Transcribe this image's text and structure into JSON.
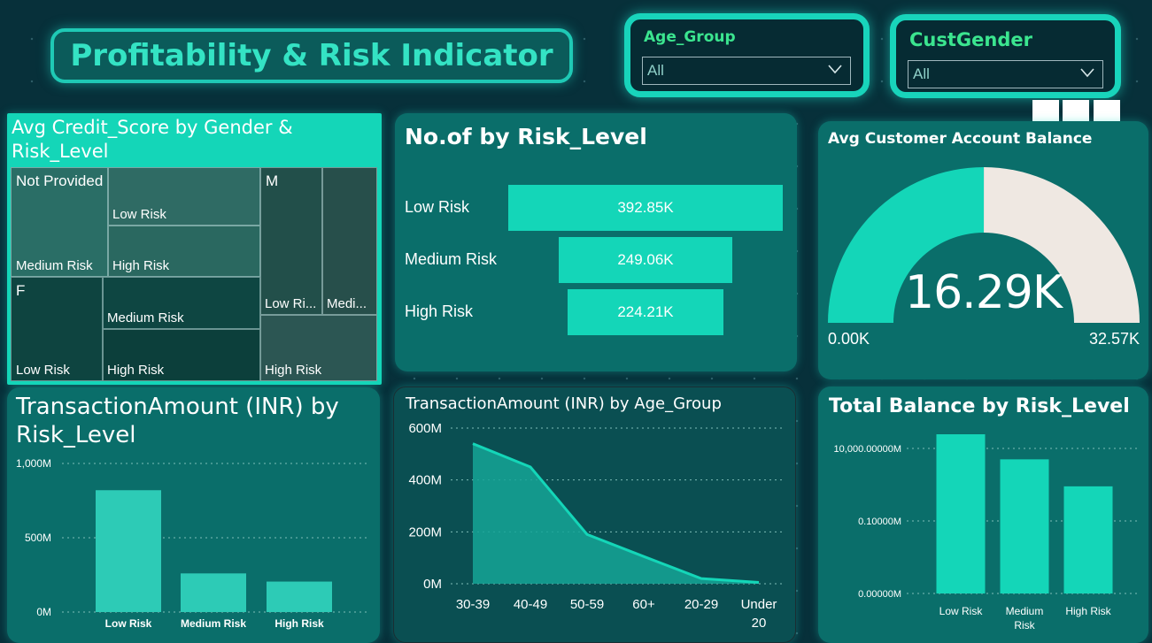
{
  "page_title": "Profitability & Risk Indicator",
  "slicers": {
    "age_group": {
      "label": "Age_Group",
      "value": "All"
    },
    "cust_gender": {
      "label": "CustGender",
      "value": "All"
    }
  },
  "colors": {
    "accent": "#14d6b8",
    "panel": "#0a6e6a",
    "background": "#07303a"
  },
  "treemap": {
    "title": "Avg Credit_Score by Gender & Risk_Level",
    "groups": [
      {
        "name": "Not Provided",
        "cells": [
          "Low Risk",
          "Medium Risk",
          "High Risk"
        ]
      },
      {
        "name": "F",
        "cells": [
          "Medium Risk",
          "Low Risk",
          "High Risk"
        ]
      },
      {
        "name": "M",
        "cells": [
          "Low Ri...",
          "Medi...",
          "High Risk"
        ]
      }
    ]
  },
  "funnel": {
    "title": "No.of by Risk_Level",
    "items": [
      {
        "label": "Low Risk",
        "value": 392.85,
        "display": "392.85K"
      },
      {
        "label": "Medium Risk",
        "value": 249.06,
        "display": "249.06K"
      },
      {
        "label": "High Risk",
        "value": 224.21,
        "display": "224.21K"
      }
    ]
  },
  "gauge": {
    "title": "Avg Customer Account Balance",
    "value": 16.29,
    "display": "16.29K",
    "min_label": "0.00K",
    "max_label": "32.57K",
    "min": 0,
    "max": 32.57
  },
  "chart_data": [
    {
      "type": "bar",
      "title": "TransactionAmount (INR) by Risk_Level",
      "categories": [
        "Low Risk",
        "Medium Risk",
        "High Risk"
      ],
      "values": [
        820,
        260,
        205
      ],
      "ylim": [
        0,
        1000
      ],
      "yticks": [
        "0M",
        "500M",
        "1,000M"
      ],
      "grid": true
    },
    {
      "type": "area",
      "title": "TransactionAmount (INR) by Age_Group",
      "categories": [
        "30-39",
        "40-49",
        "50-59",
        "60+",
        "20-29",
        "Under 20"
      ],
      "values": [
        540,
        450,
        190,
        105,
        20,
        5
      ],
      "ylim": [
        0,
        600
      ],
      "yticks": [
        "0M",
        "200M",
        "400M",
        "600M"
      ],
      "grid": true
    },
    {
      "type": "bar",
      "title": "Total Balance by Risk_Level",
      "categories": [
        "Low Risk",
        "Medium Risk",
        "High Risk"
      ],
      "values": [
        120000.0,
        5000,
        900
      ],
      "scale": "log",
      "yticks": [
        "0.00000M",
        "0.10000M",
        "10,000.00000M"
      ],
      "grid": true
    }
  ]
}
